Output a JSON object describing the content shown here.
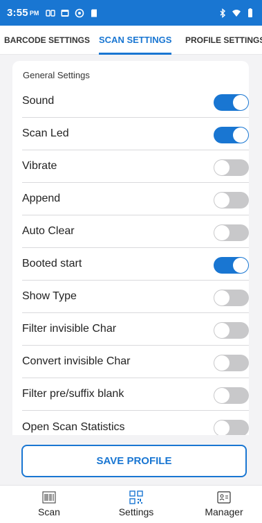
{
  "status_bar": {
    "time": "3:55",
    "ampm": "PM",
    "icons_left": [
      "sim-icon",
      "calendar-icon",
      "vpn-icon",
      "sd-card-icon"
    ],
    "icons_right": [
      "bluetooth-icon",
      "wifi-icon",
      "battery-icon"
    ]
  },
  "tabs": [
    {
      "label": "BARCODE SETTINGS",
      "active": false
    },
    {
      "label": "SCAN SETTINGS",
      "active": true
    },
    {
      "label": "PROFILE SETTINGS",
      "active": false
    }
  ],
  "group_title": "General Settings",
  "settings": [
    {
      "label": "Sound",
      "on": true
    },
    {
      "label": "Scan Led",
      "on": true
    },
    {
      "label": "Vibrate",
      "on": false
    },
    {
      "label": "Append",
      "on": false
    },
    {
      "label": "Auto Clear",
      "on": false
    },
    {
      "label": "Booted start",
      "on": true
    },
    {
      "label": "Show Type",
      "on": false
    },
    {
      "label": "Filter invisible Char",
      "on": false
    },
    {
      "label": "Convert invisible Char",
      "on": false
    },
    {
      "label": "Filter pre/suffix blank",
      "on": false
    },
    {
      "label": "Open Scan Statistics",
      "on": false
    }
  ],
  "save_button": "SAVE PROFILE",
  "bottom_nav": [
    {
      "label": "Scan",
      "icon": "barcode-icon"
    },
    {
      "label": "Settings",
      "icon": "qr-code-icon"
    },
    {
      "label": "Manager",
      "icon": "id-card-icon"
    }
  ],
  "colors": {
    "accent": "#1976d2",
    "toggle_off": "#c8c8ca",
    "background": "#f3f3f5"
  }
}
